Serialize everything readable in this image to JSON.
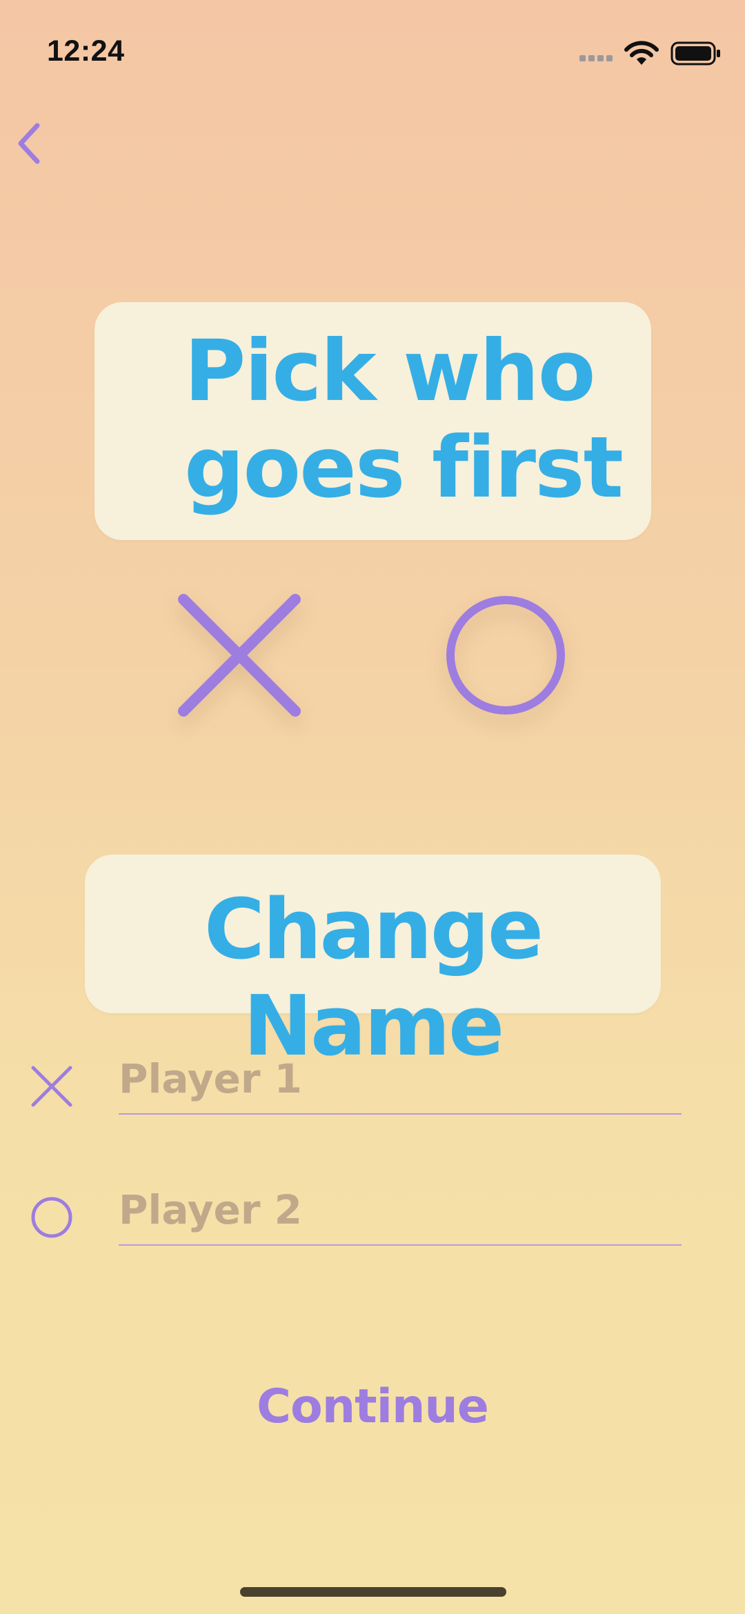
{
  "status_bar": {
    "time": "12:24",
    "icons": [
      "signal-icon",
      "wifi-icon",
      "battery-icon"
    ]
  },
  "nav": {
    "back_icon": "chevron-left-icon"
  },
  "title_card": {
    "text": "Pick who\ngoes first"
  },
  "pick_options": [
    {
      "symbol": "X",
      "icon": "x-mark-icon"
    },
    {
      "symbol": "O",
      "icon": "circle-icon"
    }
  ],
  "name_card": {
    "text": "Change Name"
  },
  "players": [
    {
      "symbol_icon": "x-mark-icon",
      "placeholder": "Player 1",
      "value": ""
    },
    {
      "symbol_icon": "circle-icon",
      "placeholder": "Player 2",
      "value": ""
    }
  ],
  "continue_label": "Continue",
  "colors": {
    "accent_purple": "#9d7de0",
    "title_blue": "#35aee6",
    "card_bg": "#f7f0da",
    "placeholder": "#c0a98a"
  }
}
